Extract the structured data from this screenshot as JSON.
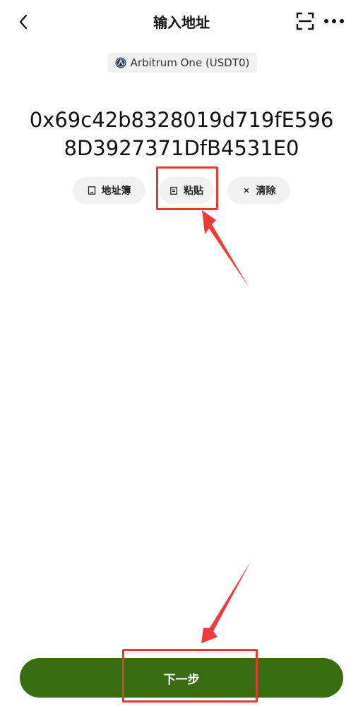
{
  "header": {
    "title": "输入地址"
  },
  "network": {
    "label": "Arbitrum One (USDT0)"
  },
  "address": {
    "line1": "0x69c42b8328019d719fE596",
    "line2": "8D3927371DfB4531E0"
  },
  "actions": {
    "address_book": "地址簿",
    "paste": "粘贴",
    "clear": "清除"
  },
  "footer": {
    "next_label": "下一步"
  },
  "colors": {
    "primary_button": "#386c13",
    "highlight": "#e53935",
    "pill_bg": "#f1f1f1"
  }
}
